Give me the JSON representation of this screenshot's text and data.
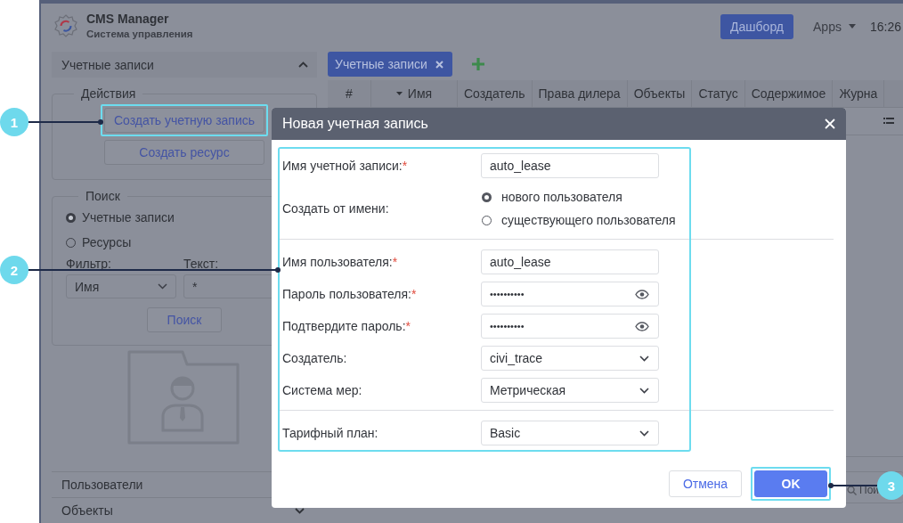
{
  "app": {
    "title": "CMS Manager",
    "subtitle": "Система управления",
    "dashboard_button": "Дашборд",
    "apps_menu": "Apps",
    "time": "16:26"
  },
  "sidebar": {
    "panel_title": "Учетные записи",
    "panel_expanded": true,
    "actions": {
      "legend": "Действия",
      "buttons": [
        "Создать учетную запись",
        "Создать ресурс"
      ]
    },
    "search": {
      "legend": "Поиск",
      "options": [
        {
          "label": "Учетные записи",
          "selected": true
        },
        {
          "label": "Ресурсы",
          "selected": false
        }
      ],
      "filter_label": "Фильтр:",
      "filter_value": "Имя",
      "text_label": "Текст:",
      "text_value": "*",
      "button": "Поиск"
    },
    "sections": [
      {
        "label": "Пользователи"
      },
      {
        "label": "Объекты",
        "expanded": false
      }
    ]
  },
  "main": {
    "tab": "Учетные записи",
    "columns": [
      {
        "label": "#",
        "sorted": false
      },
      {
        "label": "Имя",
        "sorted": true
      },
      {
        "label": "Создатель",
        "sorted": false
      },
      {
        "label": "Права дилера",
        "sorted": false
      },
      {
        "label": "Объекты",
        "sorted": false
      },
      {
        "label": "Статус",
        "sorted": false
      },
      {
        "label": "Содержимое",
        "sorted": false
      },
      {
        "label": "Журна",
        "sorted": false
      }
    ],
    "search_placeholder": "Пои"
  },
  "dialog": {
    "title": "Новая учетная запись",
    "sections": [
      {
        "fields": [
          {
            "kind": "text",
            "label": "Имя учетной записи:",
            "mark": "*",
            "value": "auto_lease"
          },
          {
            "kind": "radio",
            "label": "Создать от имени:",
            "options": [
              {
                "label": "нового пользователя",
                "selected": true
              },
              {
                "label": "существующего пользователя",
                "selected": false
              }
            ]
          }
        ]
      },
      {
        "fields": [
          {
            "kind": "text",
            "label": "Имя пользователя:",
            "mark": "*",
            "value": "auto_lease"
          },
          {
            "kind": "password",
            "label": "Пароль пользователя:",
            "mark": "*",
            "value": "••••••••••"
          },
          {
            "kind": "password",
            "label": "Подтвердите пароль:",
            "mark": "*",
            "value": "••••••••••"
          },
          {
            "kind": "select",
            "label": "Создатель:",
            "value": "civi_trace"
          },
          {
            "kind": "select",
            "label": "Система мер:",
            "value": "Метрическая"
          }
        ]
      },
      {
        "fields": [
          {
            "kind": "select",
            "label": "Тарифный план:",
            "value": "Basic"
          }
        ]
      }
    ],
    "buttons": [
      {
        "label": "Отмена",
        "primary": false
      },
      {
        "label": "OK",
        "primary": true
      }
    ]
  },
  "callouts": [
    {
      "number": "1"
    },
    {
      "number": "2"
    },
    {
      "number": "3"
    }
  ]
}
